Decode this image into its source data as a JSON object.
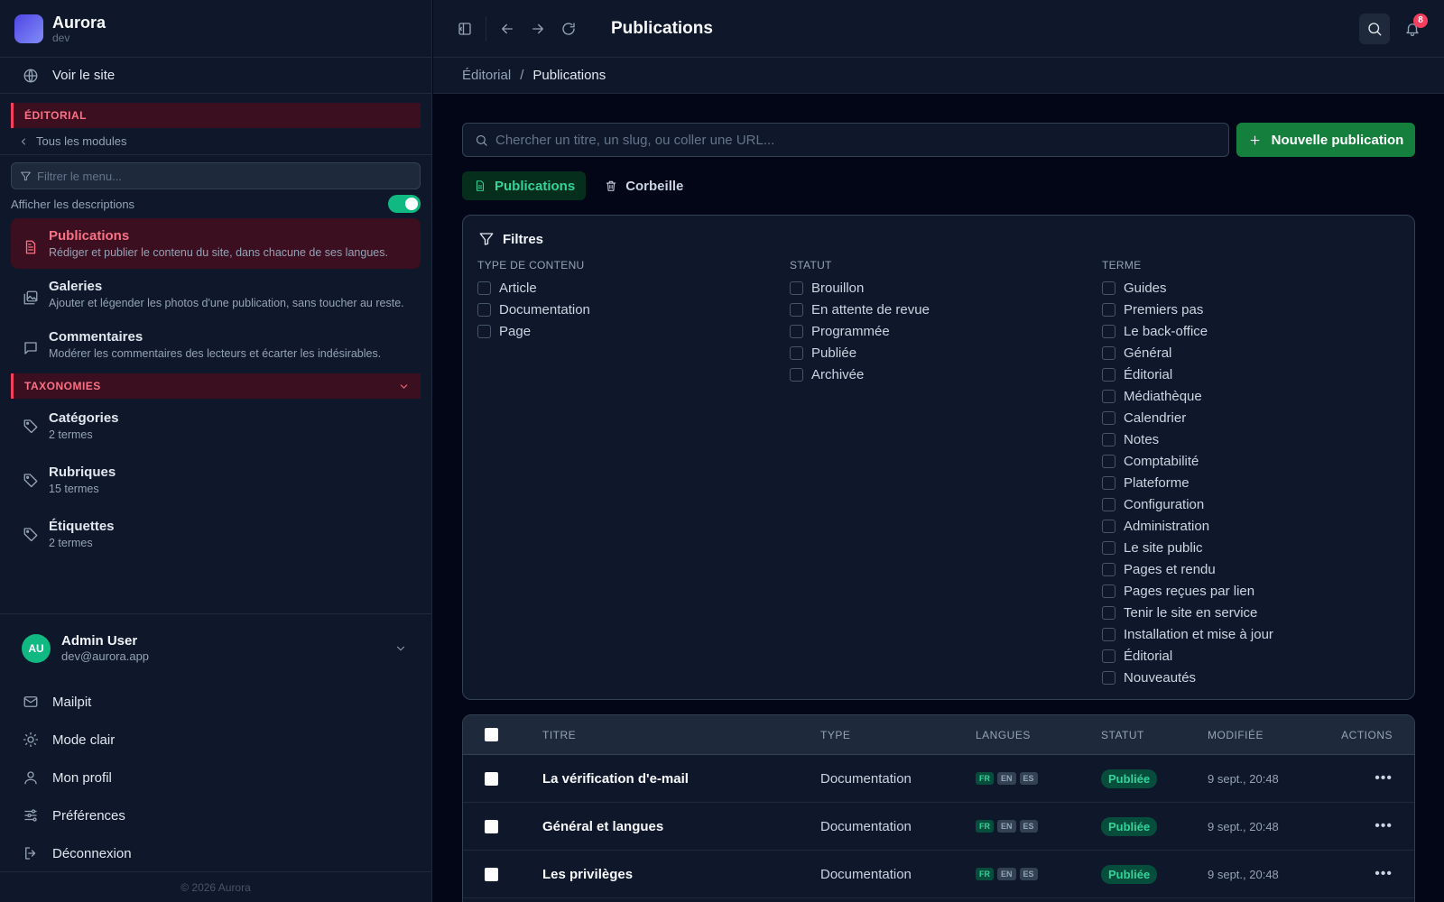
{
  "brand": {
    "name": "Aurora",
    "env": "dev"
  },
  "sidebar": {
    "view_site": "Voir le site",
    "editorial_section": "ÉDITORIAL",
    "back_link": "Tous les modules",
    "filter_placeholder": "Filtrer le menu...",
    "toggle_label": "Afficher les descriptions",
    "toggle_on": true,
    "items": [
      {
        "title": "Publications",
        "desc": "Rédiger et publier le contenu du site, dans chacune de ses langues.",
        "icon": "document-icon",
        "active": true
      },
      {
        "title": "Galeries",
        "desc": "Ajouter et légender les photos d'une publication, sans toucher au reste.",
        "icon": "gallery-icon",
        "active": false
      },
      {
        "title": "Commentaires",
        "desc": "Modérer les commentaires des lecteurs et écarter les indésirables.",
        "icon": "comment-icon",
        "active": false
      }
    ],
    "taxonomies_section": "TAXONOMIES",
    "taxonomies": [
      {
        "title": "Catégories",
        "sub": "2 termes"
      },
      {
        "title": "Rubriques",
        "sub": "15 termes"
      },
      {
        "title": "Étiquettes",
        "sub": "2 termes"
      }
    ],
    "user": {
      "initials": "AU",
      "name": "Admin User",
      "email": "dev@aurora.app"
    },
    "menu": [
      {
        "label": "Mailpit",
        "icon": "mail-icon"
      },
      {
        "label": "Mode clair",
        "icon": "sun-icon"
      },
      {
        "label": "Mon profil",
        "icon": "user-icon"
      },
      {
        "label": "Préférences",
        "icon": "sliders-icon"
      },
      {
        "label": "Déconnexion",
        "icon": "logout-icon"
      }
    ],
    "footer": "© 2026 Aurora"
  },
  "header": {
    "title": "Publications",
    "notifications": "8"
  },
  "breadcrumb": {
    "parent": "Éditorial",
    "separator": "/",
    "current": "Publications"
  },
  "main": {
    "search_placeholder": "Chercher un titre, un slug, ou coller une URL...",
    "new_button": "Nouvelle publication",
    "tabs": [
      {
        "label": "Publications",
        "active": true
      },
      {
        "label": "Corbeille",
        "active": false
      }
    ],
    "filters": {
      "title": "Filtres",
      "type_title": "TYPE DE CONTENU",
      "types": [
        "Article",
        "Documentation",
        "Page"
      ],
      "status_title": "STATUT",
      "statuses": [
        "Brouillon",
        "En attente de revue",
        "Programmée",
        "Publiée",
        "Archivée"
      ],
      "term_title": "TERME",
      "terms": [
        "Guides",
        "Premiers pas",
        "Le back-office",
        "Général",
        "Éditorial",
        "Médiathèque",
        "Calendrier",
        "Notes",
        "Comptabilité",
        "Plateforme",
        "Configuration",
        "Administration",
        "Le site public",
        "Pages et rendu",
        "Pages reçues par lien",
        "Tenir le site en service",
        "Installation et mise à jour",
        "Éditorial",
        "Nouveautés"
      ]
    },
    "table": {
      "headers": {
        "title": "TITRE",
        "type": "TYPE",
        "langs": "LANGUES",
        "status": "STATUT",
        "modified": "MODIFIÉE",
        "actions": "ACTIONS"
      },
      "rows": [
        {
          "title": "La vérification d'e-mail",
          "type": "Documentation",
          "langs": [
            "FR",
            "EN",
            "ES"
          ],
          "status": "Publiée",
          "modified": "9 sept., 20:48"
        },
        {
          "title": "Général et langues",
          "type": "Documentation",
          "langs": [
            "FR",
            "EN",
            "ES"
          ],
          "status": "Publiée",
          "modified": "9 sept., 20:48"
        },
        {
          "title": "Les privilèges",
          "type": "Documentation",
          "langs": [
            "FR",
            "EN",
            "ES"
          ],
          "status": "Publiée",
          "modified": "9 sept., 20:48"
        }
      ]
    }
  }
}
